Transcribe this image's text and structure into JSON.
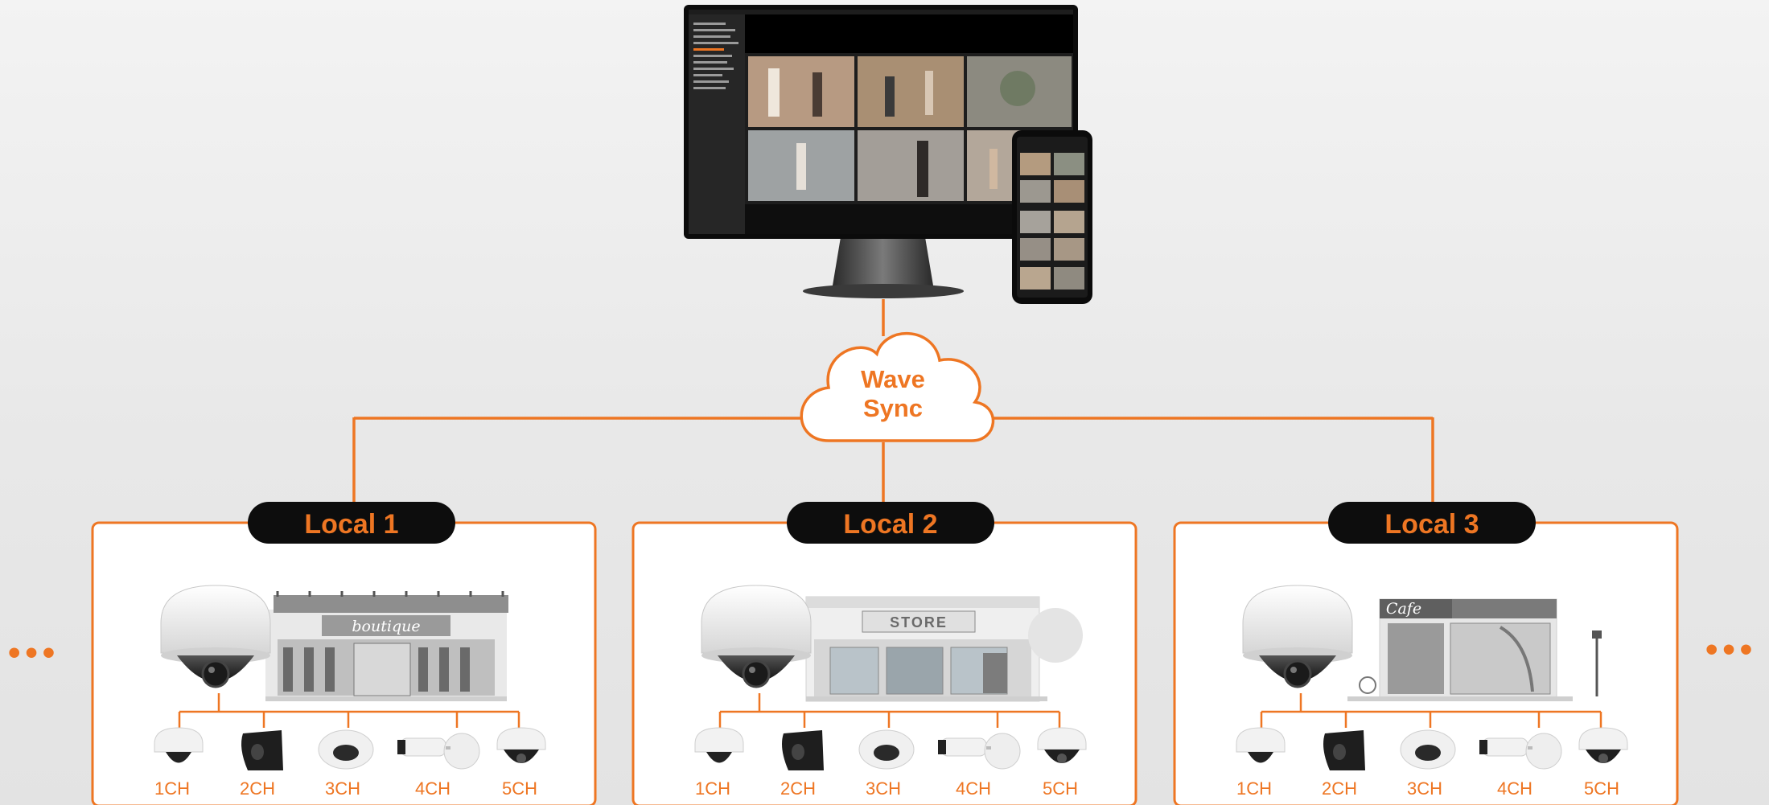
{
  "cloud": {
    "label_line1": "Wave",
    "label_line2": "Sync"
  },
  "sites": [
    {
      "tab": "Local 1",
      "sign": "boutique",
      "channels": [
        "1CH",
        "2CH",
        "3CH",
        "4CH",
        "5CH"
      ]
    },
    {
      "tab": "Local 2",
      "sign": "STORE",
      "channels": [
        "1CH",
        "2CH",
        "3CH",
        "4CH",
        "5CH"
      ]
    },
    {
      "tab": "Local 3",
      "sign": "Cafe",
      "channels": [
        "1CH",
        "2CH",
        "3CH",
        "4CH",
        "5CH"
      ]
    }
  ],
  "ellipsis": {
    "left": "•••",
    "right": "•••"
  },
  "icons": {
    "monitor": "monitor-icon",
    "phone": "smartphone-icon",
    "cloud": "cloud-icon",
    "main_camera": "dome-camera-icon",
    "building": "storefront-icon",
    "channel_cameras": [
      "mini-dome-camera-icon",
      "wedge-camera-icon",
      "flat-dome-camera-icon",
      "bullet-camera-icon",
      "ptz-dome-camera-icon"
    ]
  },
  "colors": {
    "accent": "#ee7623",
    "tab_bg": "#0d0d0d",
    "panel_bg": "#ffffff",
    "background": "#e8e8e8"
  }
}
